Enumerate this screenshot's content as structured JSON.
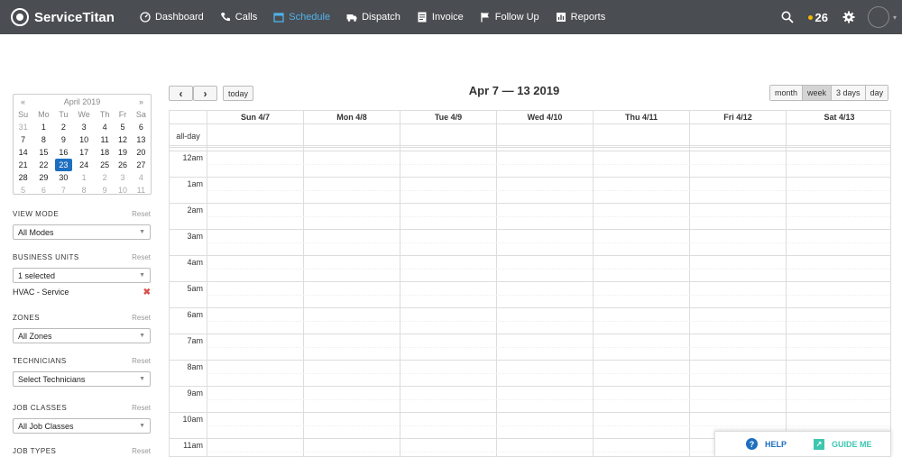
{
  "nav": {
    "brand": "ServiceTitan",
    "items": [
      {
        "label": "Dashboard",
        "icon": "dashboard-icon",
        "active": false
      },
      {
        "label": "Calls",
        "icon": "phone-icon",
        "active": false
      },
      {
        "label": "Schedule",
        "icon": "calendar-icon",
        "active": true
      },
      {
        "label": "Dispatch",
        "icon": "truck-icon",
        "active": false
      },
      {
        "label": "Invoice",
        "icon": "invoice-icon",
        "active": false
      },
      {
        "label": "Follow Up",
        "icon": "flag-icon",
        "active": false
      },
      {
        "label": "Reports",
        "icon": "chart-icon",
        "active": false
      }
    ],
    "notification_count": "26",
    "active_color": "#4fb3ea",
    "bar_color": "#4a4d52"
  },
  "mini_calendar": {
    "prev": "«",
    "next": "»",
    "title": "April 2019",
    "dow": [
      "Su",
      "Mo",
      "Tu",
      "We",
      "Th",
      "Fr",
      "Sa"
    ],
    "weeks": [
      [
        "31",
        "1",
        "2",
        "3",
        "4",
        "5",
        "6"
      ],
      [
        "7",
        "8",
        "9",
        "10",
        "11",
        "12",
        "13"
      ],
      [
        "14",
        "15",
        "16",
        "17",
        "18",
        "19",
        "20"
      ],
      [
        "21",
        "22",
        "23",
        "24",
        "25",
        "26",
        "27"
      ],
      [
        "28",
        "29",
        "30",
        "1",
        "2",
        "3",
        "4"
      ],
      [
        "5",
        "6",
        "7",
        "8",
        "9",
        "10",
        "11"
      ]
    ],
    "selected": "23",
    "selected_color": "#1f6fc0"
  },
  "filters": {
    "reset_label": "Reset",
    "view_mode": {
      "label": "VIEW MODE",
      "value": "All Modes"
    },
    "business_units": {
      "label": "BUSINESS UNITS",
      "value": "1 selected",
      "selected_item": "HVAC - Service"
    },
    "zones": {
      "label": "ZONES",
      "value": "All Zones"
    },
    "technicians": {
      "label": "TECHNICIANS",
      "value": "Select Technicians"
    },
    "job_classes": {
      "label": "JOB CLASSES",
      "value": "All Job Classes"
    },
    "job_types": {
      "label": "JOB TYPES"
    }
  },
  "calendar": {
    "prev_label": "‹",
    "next_label": "›",
    "today_label": "today",
    "title": "Apr 7 — 13 2019",
    "views": [
      "month",
      "week",
      "3 days",
      "day"
    ],
    "active_view": "week",
    "days": [
      "Sun 4/7",
      "Mon 4/8",
      "Tue 4/9",
      "Wed 4/10",
      "Thu 4/11",
      "Fri 4/12",
      "Sat 4/13"
    ],
    "allday_label": "all-day",
    "hours": [
      "12am",
      "1am",
      "2am",
      "3am",
      "4am",
      "5am",
      "6am",
      "7am",
      "8am",
      "9am",
      "10am",
      "11am"
    ]
  },
  "help_widget": {
    "help_label": "HELP",
    "guide_label": "GUIDE ME",
    "help_color": "#1f6fc0",
    "guide_color": "#3ec6b0"
  }
}
